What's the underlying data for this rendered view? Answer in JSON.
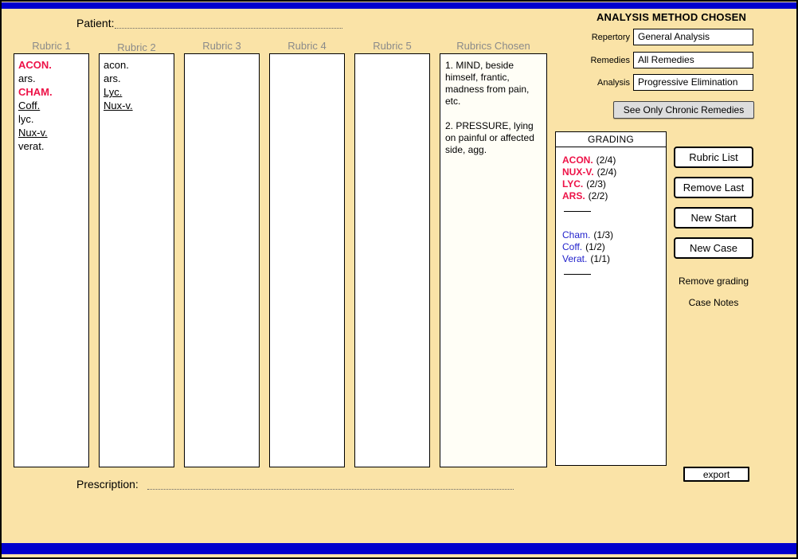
{
  "colors": {
    "background": "#FAE3A7",
    "bar_blue": "#0000CD",
    "grade_red": "#ED1247",
    "remedy_blue": "#2222CC",
    "header_gray": "#8A8A8A"
  },
  "top": {
    "patient_label": "Patient:"
  },
  "bottom": {
    "prescription_label": "Prescription:"
  },
  "columns": {
    "rubric1": {
      "header": "Rubric 1",
      "items": [
        {
          "text": "ACON.",
          "grade": "3"
        },
        {
          "text": "ars.",
          "grade": "1"
        },
        {
          "text": "CHAM.",
          "grade": "3"
        },
        {
          "text": "Coff.",
          "grade": "2"
        },
        {
          "text": "lyc.",
          "grade": "1"
        },
        {
          "text": "Nux-v.",
          "grade": "2"
        },
        {
          "text": "verat.",
          "grade": "1"
        }
      ]
    },
    "rubric2": {
      "header": "Rubric 2",
      "items": [
        {
          "text": "acon.",
          "grade": "1"
        },
        {
          "text": "ars.",
          "grade": "1"
        },
        {
          "text": "Lyc.",
          "grade": "2"
        },
        {
          "text": "Nux-v.",
          "grade": "2"
        }
      ]
    },
    "rubric3": {
      "header": "Rubric 3"
    },
    "rubric4": {
      "header": "Rubric 4"
    },
    "rubric5": {
      "header": "Rubric 5"
    },
    "chosen": {
      "header": "Rubrics Chosen",
      "entries": [
        "1. MIND, beside himself, frantic, madness from pain, etc.",
        "2. PRESSURE, lying on painful or affected side, agg."
      ]
    }
  },
  "analysis_panel": {
    "title": "ANALYSIS METHOD CHOSEN",
    "fields": [
      {
        "label": "Repertory",
        "value": "General Analysis"
      },
      {
        "label": "Remedies",
        "value": "All Remedies"
      },
      {
        "label": "Analysis",
        "value": "Progressive Elimination"
      }
    ],
    "chronic_button": "See Only Chronic Remedies"
  },
  "grading": {
    "title": "GRADING",
    "primary": [
      {
        "name": "ACON.",
        "score": "(2/4)"
      },
      {
        "name": "NUX-V.",
        "score": "(2/4)"
      },
      {
        "name": "LYC.",
        "score": "(2/3)"
      },
      {
        "name": "ARS.",
        "score": "(2/2)"
      }
    ],
    "secondary": [
      {
        "name": "Cham.",
        "score": "(1/3)"
      },
      {
        "name": "Coff.",
        "score": "(1/2)"
      },
      {
        "name": "Verat.",
        "score": "(1/1)"
      }
    ]
  },
  "actions": {
    "rubric_list": "Rubric List",
    "remove_last": "Remove Last",
    "new_start": "New Start",
    "new_case": "New Case",
    "remove_grading": "Remove grading",
    "case_notes": "Case Notes",
    "export": "export"
  }
}
